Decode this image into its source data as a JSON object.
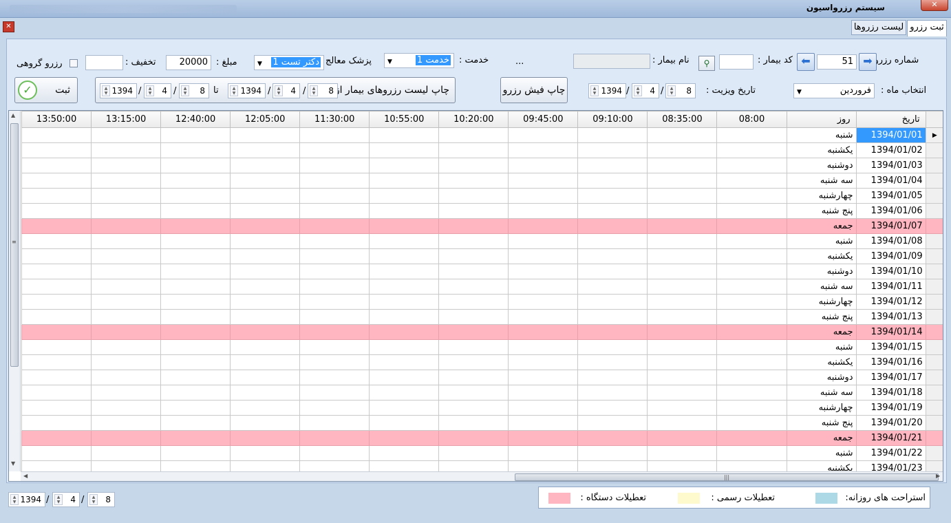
{
  "window": {
    "title": "سیستم رزرواسیون"
  },
  "tabs": [
    {
      "label": "ثبت رزرو"
    },
    {
      "label": "لیست رزروها"
    }
  ],
  "form": {
    "reserve_no_label": "شماره رزرو :",
    "reserve_no": "51",
    "patient_code_label": "کد بیمار :",
    "patient_code": "",
    "patient_name_label": "نام بیمار :",
    "patient_name": "",
    "ellipsis": "...",
    "service_label": "خدمت :",
    "service_value": "خدمت 1",
    "doctor_label": "پزشک معالج",
    "doctor_value": "دکتر تست 1",
    "amount_label": "مبلغ :",
    "amount": "20000",
    "discount_label": "تخفیف :",
    "discount": "",
    "group_label": "رزرو گروهی",
    "month_label": "انتخاب ماه :",
    "month_value": "فروردین",
    "visit_date_label": "تاریخ ویزیت :",
    "visit_day": "8",
    "visit_month": "4",
    "visit_year": "1394",
    "print_receipt": "چاپ فیش رزرو",
    "print_list": "چاپ لیست رزروهای بیمار از",
    "from_day": "8",
    "from_month": "4",
    "from_year": "1394",
    "to_label": "تا",
    "to_day": "8",
    "to_month": "4",
    "to_year": "1394",
    "submit": "ثبت",
    "slash": "/"
  },
  "grid": {
    "headers": [
      "تاریخ",
      "روز",
      "08:00",
      "08:35:00",
      "09:10:00",
      "09:45:00",
      "10:20:00",
      "10:55:00",
      "11:30:00",
      "12:05:00",
      "12:40:00",
      "13:15:00",
      "13:50:00"
    ],
    "rows": [
      {
        "date": "1394/01/01",
        "day": "شنبه",
        "holiday": false,
        "selected": true
      },
      {
        "date": "1394/01/02",
        "day": "یکشنبه",
        "holiday": false
      },
      {
        "date": "1394/01/03",
        "day": "دوشنبه",
        "holiday": false
      },
      {
        "date": "1394/01/04",
        "day": "سه شنبه",
        "holiday": false
      },
      {
        "date": "1394/01/05",
        "day": "چهارشنبه",
        "holiday": false
      },
      {
        "date": "1394/01/06",
        "day": "پنج شنبه",
        "holiday": false
      },
      {
        "date": "1394/01/07",
        "day": "جمعه",
        "holiday": true
      },
      {
        "date": "1394/01/08",
        "day": "شنبه",
        "holiday": false
      },
      {
        "date": "1394/01/09",
        "day": "یکشنبه",
        "holiday": false
      },
      {
        "date": "1394/01/10",
        "day": "دوشنبه",
        "holiday": false
      },
      {
        "date": "1394/01/11",
        "day": "سه شنبه",
        "holiday": false
      },
      {
        "date": "1394/01/12",
        "day": "چهارشنبه",
        "holiday": false
      },
      {
        "date": "1394/01/13",
        "day": "پنج شنبه",
        "holiday": false
      },
      {
        "date": "1394/01/14",
        "day": "جمعه",
        "holiday": true
      },
      {
        "date": "1394/01/15",
        "day": "شنبه",
        "holiday": false
      },
      {
        "date": "1394/01/16",
        "day": "یکشنبه",
        "holiday": false
      },
      {
        "date": "1394/01/17",
        "day": "دوشنبه",
        "holiday": false
      },
      {
        "date": "1394/01/18",
        "day": "سه شنبه",
        "holiday": false
      },
      {
        "date": "1394/01/19",
        "day": "چهارشنبه",
        "holiday": false
      },
      {
        "date": "1394/01/20",
        "day": "پنج شنبه",
        "holiday": false
      },
      {
        "date": "1394/01/21",
        "day": "جمعه",
        "holiday": true
      },
      {
        "date": "1394/01/22",
        "day": "شنبه",
        "holiday": false
      },
      {
        "date": "1394/01/23",
        "day": "یکشنبه",
        "holiday": false
      }
    ]
  },
  "footer": {
    "day": "8",
    "month": "4",
    "year": "1394",
    "legend_rest": "استراحت های روزانه:",
    "legend_official": "تعطیلات رسمی :",
    "legend_device": "تعطیلات دستگاه :",
    "colors": {
      "rest": "#add8e6",
      "official": "#fffacd",
      "device": "#ffb6c1"
    }
  }
}
